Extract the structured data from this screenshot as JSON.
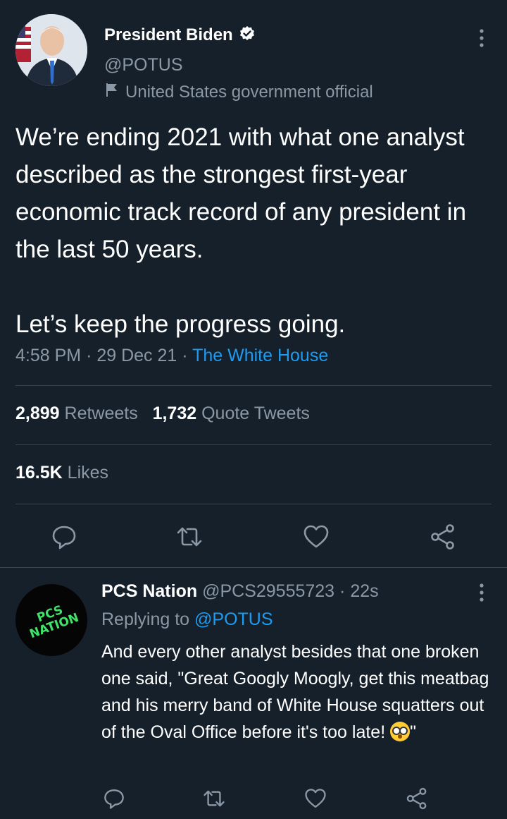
{
  "main_tweet": {
    "display_name": "President Biden",
    "verified": true,
    "handle": "@POTUS",
    "account_label": "United States government official",
    "text": "We’re ending 2021 with what one analyst described as the strongest first-year economic track record of any president in the last 50 years.\n\nLet’s keep the progress going.",
    "time": "4:58 PM",
    "date": "29 Dec 21",
    "source": "The White House",
    "sep": "·",
    "retweets_count": "2,899",
    "retweets_label": "Retweets",
    "quote_tweets_count": "1,732",
    "quote_tweets_label": "Quote Tweets",
    "likes_count": "16.5K",
    "likes_label": "Likes"
  },
  "reply": {
    "display_name": "PCS Nation",
    "handle": "@PCS29555723",
    "sep": "·",
    "time_ago": "22s",
    "replying_prefix": "Replying to",
    "replying_to": "@POTUS",
    "avatar_text": "PCS NATION",
    "text_before_emoji": "And every other analyst besides that one broken one said, \"Great Googly Moogly, get this meatbag and his merry band of White House squatters out of the Oval Office before it's too late! ",
    "text_after_emoji": "\"",
    "emoji": "flushed-face"
  },
  "icons": {
    "reply": "reply-icon",
    "retweet": "retweet-icon",
    "like": "heart-icon",
    "share": "share-icon",
    "more": "more-vertical-icon",
    "verified": "verified-badge-icon",
    "label_flag": "flag-icon"
  },
  "colors": {
    "background": "#15202b",
    "text": "#ffffff",
    "muted": "#8b98a5",
    "link": "#1d9bf0",
    "divider": "#38444d"
  }
}
